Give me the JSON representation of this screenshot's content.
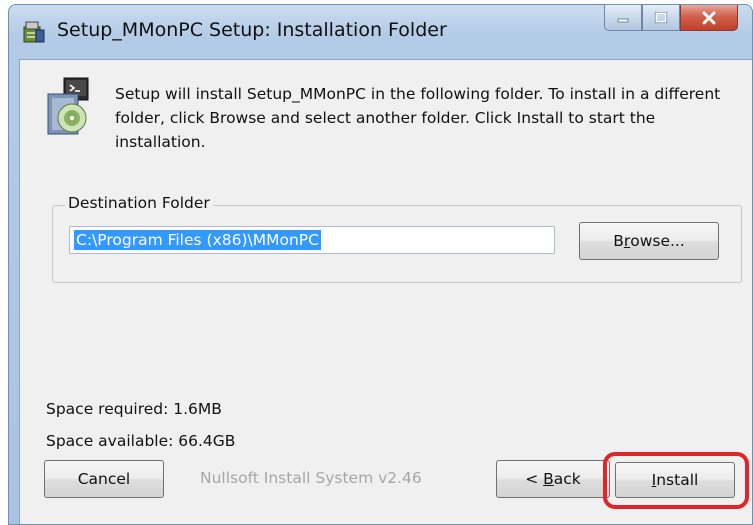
{
  "window": {
    "title": "Setup_MMonPC Setup: Installation Folder"
  },
  "header": {
    "description": "Setup will install Setup_MMonPC in the following folder. To install in a different folder, click Browse and select another folder. Click Install to start the installation."
  },
  "destination": {
    "group_label": "Destination Folder",
    "path": "C:\\Program Files (x86)\\MMonPC",
    "browse_label_pre": "B",
    "browse_label_u": "r",
    "browse_label_post": "owse..."
  },
  "space": {
    "required": "Space required: 1.6MB",
    "available": "Space available: 66.4GB"
  },
  "footer": {
    "branding": "Nullsoft Install System v2.46",
    "cancel_label": "Cancel",
    "back_label_pre": "< ",
    "back_label_u": "B",
    "back_label_post": "ack",
    "install_label_u": "I",
    "install_label_post": "nstall"
  },
  "colors": {
    "highlight": "#e0242a",
    "selection": "#3399ff"
  },
  "icons": {
    "app": "installer-package-icon",
    "header": "installer-disc-icon",
    "minimize": "minimize-icon",
    "maximize": "maximize-icon",
    "close": "close-icon"
  }
}
